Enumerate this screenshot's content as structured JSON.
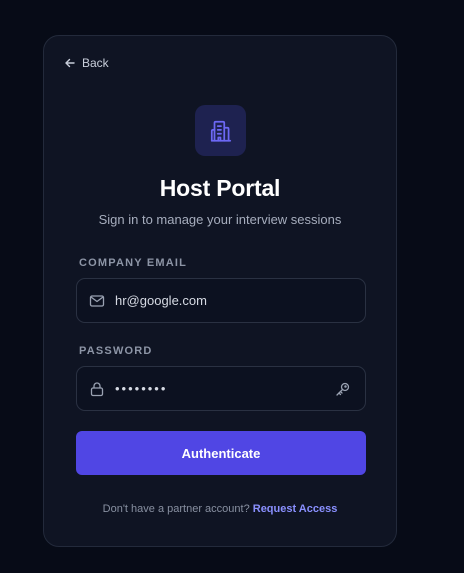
{
  "nav": {
    "back_label": "Back"
  },
  "header": {
    "title": "Host Portal",
    "subtitle": "Sign in to manage your interview sessions"
  },
  "form": {
    "email": {
      "label": "COMPANY EMAIL",
      "value": "hr@google.com",
      "icon": "mail-icon"
    },
    "password": {
      "label": "PASSWORD",
      "value": "••••••••",
      "icon": "lock-icon",
      "toggle_icon": "key-icon"
    },
    "submit_label": "Authenticate"
  },
  "footer": {
    "prompt": "Don't have a partner account?",
    "link_label": "Request Access"
  },
  "colors": {
    "background": "#070b17",
    "card": "#0f1423",
    "accent": "#5046e4",
    "link": "#8a90ff",
    "logo_bg": "#1e2250",
    "logo_icon": "#6d68f5"
  }
}
